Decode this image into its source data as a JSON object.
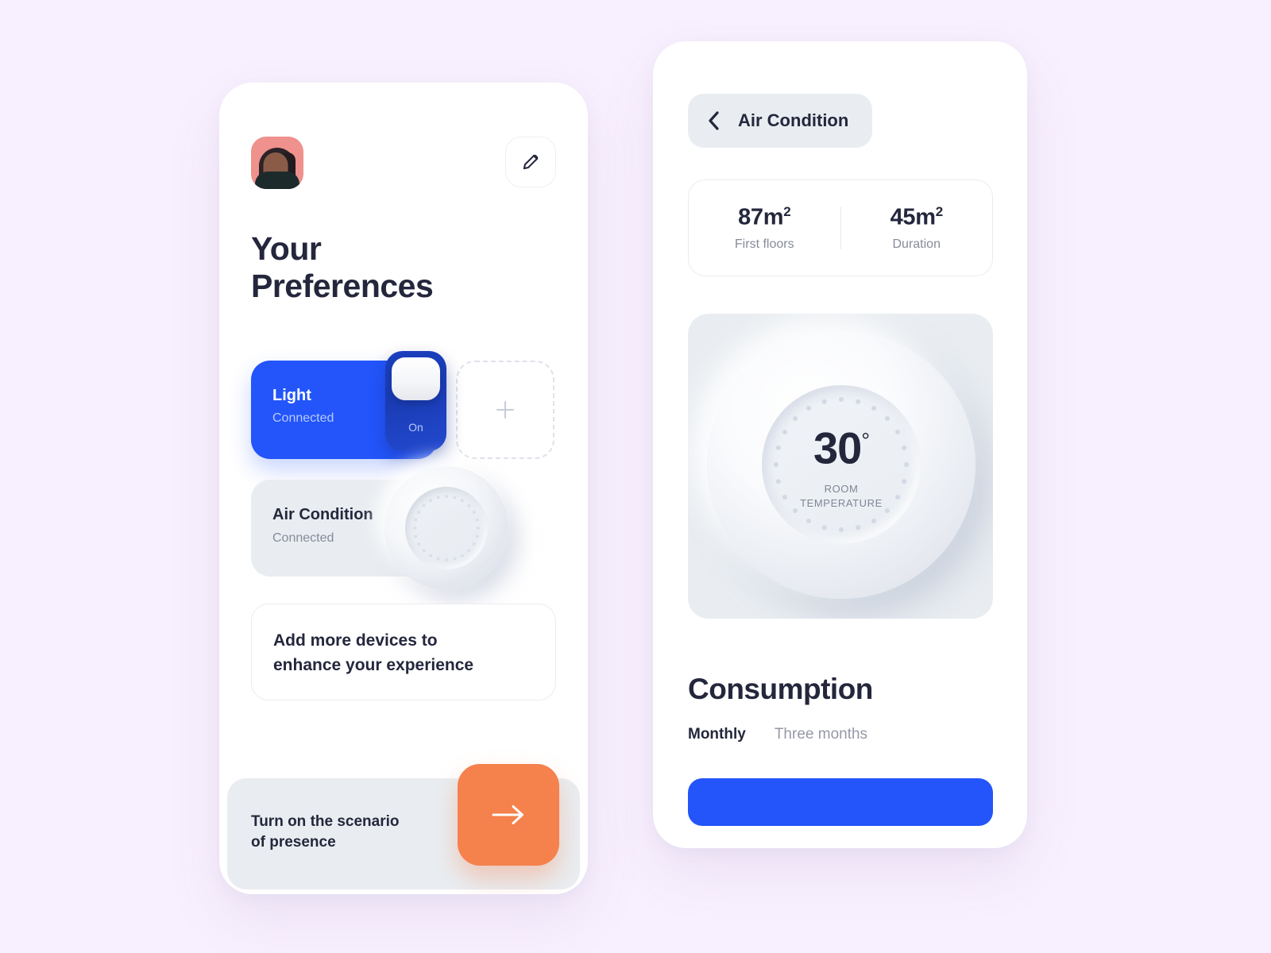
{
  "background_color": "#f8f0fe",
  "accent": {
    "blue": "#2355fb",
    "orange": "#f5814c",
    "dark": "#24273c",
    "muted": "#868b99",
    "panel": "#e9edf1"
  },
  "left_screen": {
    "avatar_alt": "user-avatar",
    "edit_icon": "pencil-icon",
    "title_line1": "Your",
    "title_line2": "Preferences",
    "devices": [
      {
        "name": "Light",
        "status": "Connected",
        "toggle_state": "On",
        "active": true
      },
      {
        "name": "Air Condition",
        "status": "Connected",
        "active": false
      }
    ],
    "add_device": {
      "icon": "plus-icon",
      "label": ""
    },
    "promo": {
      "line1": "Add more devices to",
      "line2": "enhance your experience"
    },
    "scenario": {
      "line1": "Turn on the scenario",
      "line2": "of presence",
      "button_icon": "arrow-right-icon"
    }
  },
  "right_screen": {
    "back_icon": "chevron-left-icon",
    "header_title": "Air Condition",
    "stats": [
      {
        "value": "87m",
        "unit": "2",
        "label": "First floors"
      },
      {
        "value": "45m",
        "unit": "2",
        "label": "Duration"
      }
    ],
    "thermostat": {
      "temperature": "30",
      "degree_symbol": "°",
      "caption_line1": "ROOM",
      "caption_line2": "TEMPERATURE",
      "tick_count": 24
    },
    "consumption": {
      "title": "Consumption",
      "tabs": [
        {
          "label": "Monthly",
          "active": true
        },
        {
          "label": "Three months",
          "active": false
        }
      ],
      "bar_color": "#2355fb"
    }
  }
}
